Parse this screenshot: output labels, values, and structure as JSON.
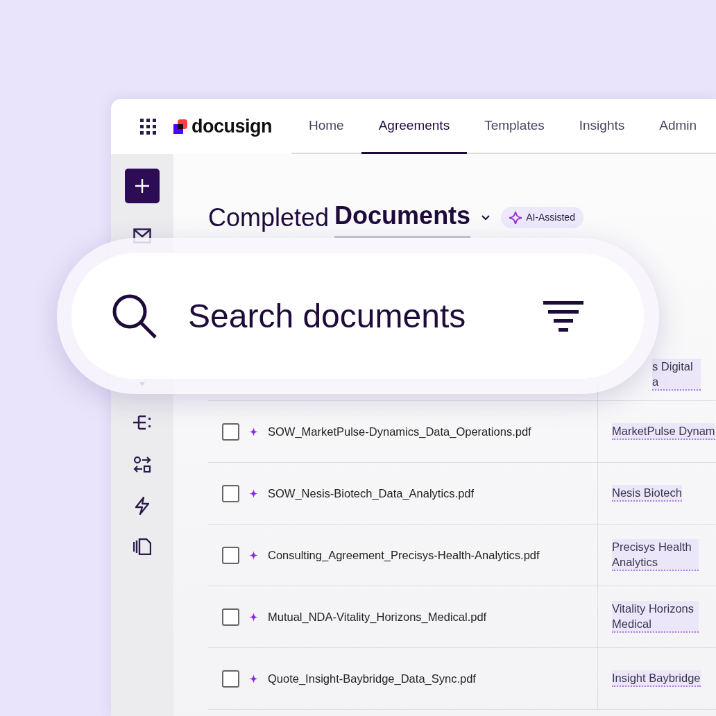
{
  "nav": {
    "brand": "docusign",
    "tabs": [
      {
        "label": "Home",
        "selected": false
      },
      {
        "label": "Agreements",
        "selected": true
      },
      {
        "label": "Templates",
        "selected": false
      },
      {
        "label": "Insights",
        "selected": false
      },
      {
        "label": "Admin",
        "selected": false
      }
    ]
  },
  "heading": {
    "prefix": "Completed",
    "title": "Documents",
    "badge": "AI-Assisted"
  },
  "search": {
    "placeholder": "Search documents"
  },
  "table": {
    "rows": [
      {
        "company": "s Digital a"
      },
      {
        "document": "SOW_MarketPulse-Dynamics_Data_Operations.pdf",
        "company": "MarketPulse Dynam",
        "checked": false
      },
      {
        "document": "SOW_Nesis-Biotech_Data_Analytics.pdf",
        "company": "Nesis Biotech",
        "checked": false
      },
      {
        "document": "Consulting_Agreement_Precisys-Health-Analytics.pdf",
        "company": "Precisys Health Analytics",
        "checked": false
      },
      {
        "document": "Mutual_NDA-Vitality_Horizons_Medical.pdf",
        "company": "Vitality Horizons Medical",
        "checked": false
      },
      {
        "document": "Quote_Insight-Baybridge_Data_Sync.pdf",
        "company": "Insight Baybridge",
        "checked": false
      }
    ]
  }
}
